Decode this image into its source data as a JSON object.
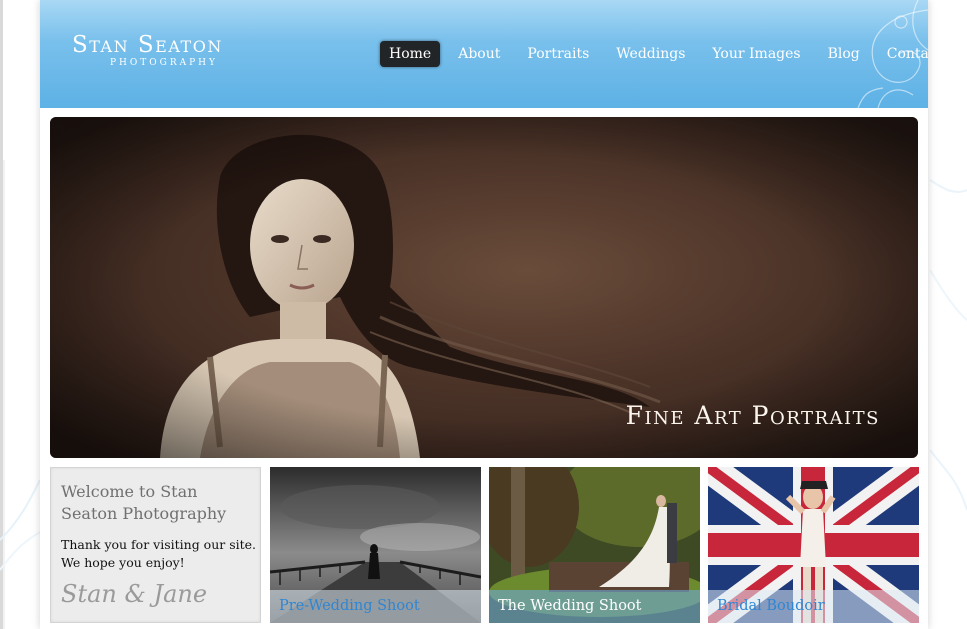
{
  "site": {
    "logo_title": "Stan Seaton",
    "logo_subtitle": "Photography"
  },
  "nav": {
    "items": [
      {
        "label": "Home",
        "active": true
      },
      {
        "label": "About",
        "active": false
      },
      {
        "label": "Portraits",
        "active": false
      },
      {
        "label": "Weddings",
        "active": false
      },
      {
        "label": "Your Images",
        "active": false
      },
      {
        "label": "Blog",
        "active": false
      },
      {
        "label": "Contact",
        "active": false
      }
    ]
  },
  "hero": {
    "caption": "Fine Art Portraits"
  },
  "welcome": {
    "heading": "Welcome to Stan Seaton Photography",
    "body": "Thank you for visiting our site. We hope you enjoy!",
    "signature": "Stan & Jane"
  },
  "tiles": [
    {
      "label": "Pre-Wedding Shoot"
    },
    {
      "label": "The Wedding Shoot"
    },
    {
      "label": "Bridal Boudoir"
    }
  ],
  "colors": {
    "header_blue": "#5db1e5",
    "nav_active_bg": "#222528",
    "tile_label_blue": "#2f86d2"
  }
}
